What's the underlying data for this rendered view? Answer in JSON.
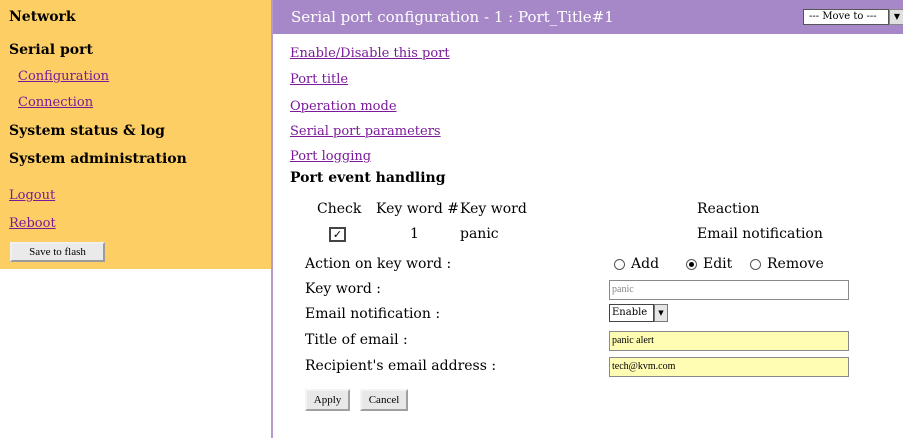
{
  "sidebar": {
    "network": "Network",
    "serial_port": "Serial port",
    "configuration": "Configuration",
    "connection": "Connection",
    "system_status": "System status & log",
    "system_admin": "System administration",
    "logout": "Logout",
    "reboot": "Reboot",
    "save_label": "Save to flash"
  },
  "header": {
    "title": "Serial port configuration - 1 : Port_Title#1",
    "move_to": "--- Move to ---"
  },
  "links": {
    "enable_disable": "Enable/Disable this port",
    "port_title": "Port title",
    "operation_mode": "Operation mode",
    "serial_params": "Serial port parameters",
    "port_logging": "Port logging"
  },
  "section_title": "Port event handling",
  "event_table": {
    "headers": {
      "check": "Check",
      "key_no": "Key word #",
      "key_word": "Key word",
      "reaction": "Reaction"
    },
    "rows": [
      {
        "number": "1",
        "key_word": "panic",
        "reaction": "Email notification",
        "checked": true
      }
    ]
  },
  "form": {
    "action_label": "Action on key word :",
    "action_options": [
      "Add",
      "Edit",
      "Remove"
    ],
    "action_selected": "Edit",
    "keyword_label": "Key word :",
    "keyword_value": "panic",
    "email_notif_label": "Email notification :",
    "email_notif_value": "Enable",
    "title_label": "Title of email :",
    "title_value": "panic alert",
    "recipient_label": "Recipient's email address :",
    "recipient_value": "tech@kvm.com"
  },
  "buttons": {
    "apply": "Apply",
    "cancel": "Cancel"
  },
  "colors": {
    "sidebar_bg": "#fdce64",
    "header_bg": "#a688c8",
    "link": "#7a1a9a",
    "field_highlight": "#fffcb4"
  }
}
